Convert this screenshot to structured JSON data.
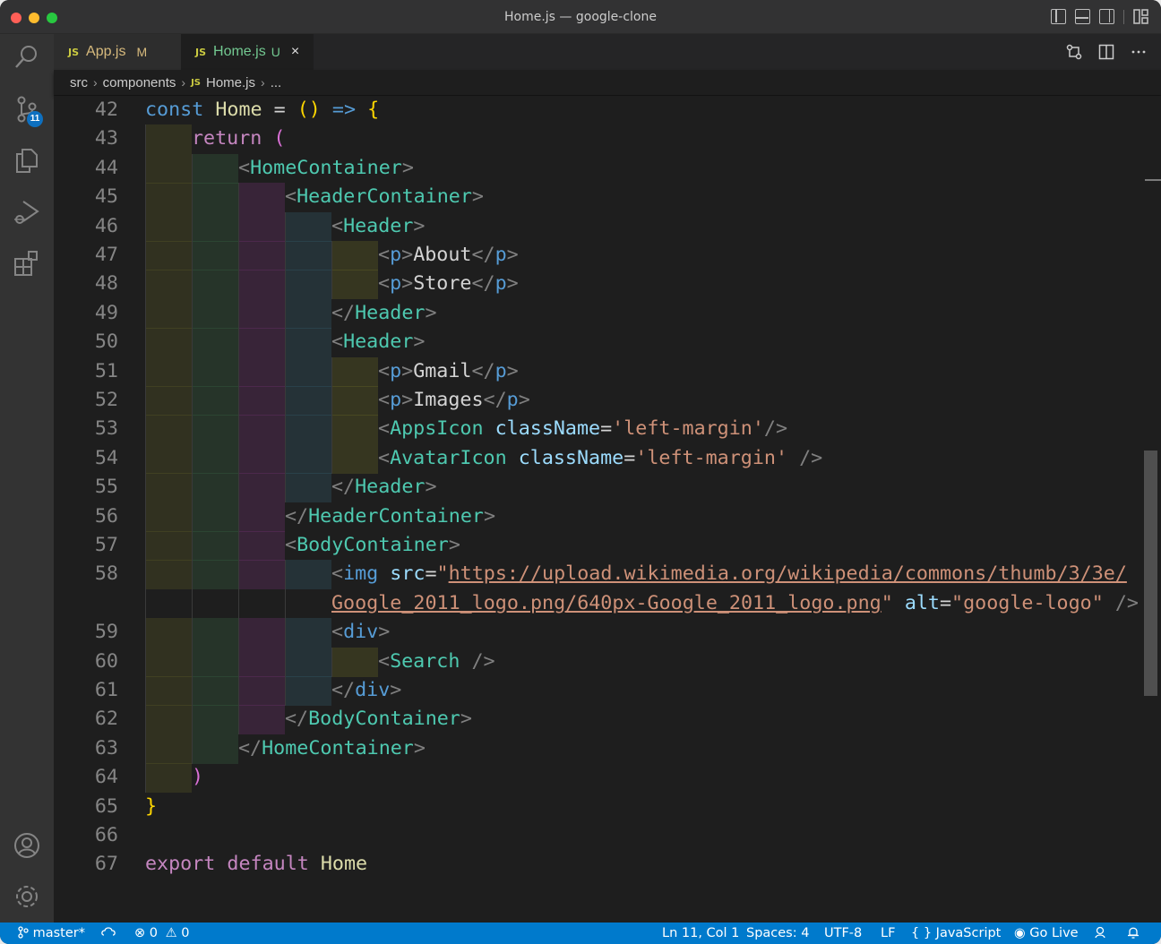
{
  "window": {
    "title": "Home.js — google-clone"
  },
  "activity": {
    "scm_badge": "11"
  },
  "tabs": [
    {
      "icon": "JS",
      "label": "App.js",
      "status": "M"
    },
    {
      "icon": "JS",
      "label": "Home.js",
      "status": "U",
      "close": "×"
    }
  ],
  "breadcrumb": {
    "items": [
      "src",
      "components",
      "Home.js",
      "..."
    ],
    "file_icon": "JS"
  },
  "editor": {
    "line_numbers": [
      "42",
      "43",
      "44",
      "45",
      "46",
      "47",
      "48",
      "49",
      "50",
      "51",
      "52",
      "53",
      "54",
      "55",
      "56",
      "57",
      "58",
      "",
      "59",
      "60",
      "61",
      "62",
      "63",
      "64",
      "65",
      "66",
      "67"
    ],
    "lines": [
      [
        {
          "t": "const ",
          "c": "kw"
        },
        {
          "t": "Home",
          "c": "fn"
        },
        {
          "t": " = ",
          "c": "txt"
        },
        {
          "t": "()",
          "c": "br1"
        },
        {
          "t": " => ",
          "c": "kw"
        },
        {
          "t": "{",
          "c": "br1"
        }
      ],
      [
        {
          "t": "return ",
          "c": "kwc"
        },
        {
          "t": "(",
          "c": "br2"
        }
      ],
      [
        {
          "t": "<",
          "c": "pun"
        },
        {
          "t": "HomeContainer",
          "c": "tag"
        },
        {
          "t": ">",
          "c": "pun"
        }
      ],
      [
        {
          "t": "<",
          "c": "pun"
        },
        {
          "t": "HeaderContainer",
          "c": "tag"
        },
        {
          "t": ">",
          "c": "pun"
        }
      ],
      [
        {
          "t": "<",
          "c": "pun"
        },
        {
          "t": "Header",
          "c": "tag"
        },
        {
          "t": ">",
          "c": "pun"
        }
      ],
      [
        {
          "t": "<",
          "c": "pun"
        },
        {
          "t": "p",
          "c": "htag"
        },
        {
          "t": ">",
          "c": "pun"
        },
        {
          "t": "About",
          "c": "txt"
        },
        {
          "t": "</",
          "c": "pun"
        },
        {
          "t": "p",
          "c": "htag"
        },
        {
          "t": ">",
          "c": "pun"
        }
      ],
      [
        {
          "t": "<",
          "c": "pun"
        },
        {
          "t": "p",
          "c": "htag"
        },
        {
          "t": ">",
          "c": "pun"
        },
        {
          "t": "Store",
          "c": "txt"
        },
        {
          "t": "</",
          "c": "pun"
        },
        {
          "t": "p",
          "c": "htag"
        },
        {
          "t": ">",
          "c": "pun"
        }
      ],
      [
        {
          "t": "</",
          "c": "pun"
        },
        {
          "t": "Header",
          "c": "tag"
        },
        {
          "t": ">",
          "c": "pun"
        }
      ],
      [
        {
          "t": "<",
          "c": "pun"
        },
        {
          "t": "Header",
          "c": "tag"
        },
        {
          "t": ">",
          "c": "pun"
        }
      ],
      [
        {
          "t": "<",
          "c": "pun"
        },
        {
          "t": "p",
          "c": "htag"
        },
        {
          "t": ">",
          "c": "pun"
        },
        {
          "t": "Gmail",
          "c": "txt"
        },
        {
          "t": "</",
          "c": "pun"
        },
        {
          "t": "p",
          "c": "htag"
        },
        {
          "t": ">",
          "c": "pun"
        }
      ],
      [
        {
          "t": "<",
          "c": "pun"
        },
        {
          "t": "p",
          "c": "htag"
        },
        {
          "t": ">",
          "c": "pun"
        },
        {
          "t": "Images",
          "c": "txt"
        },
        {
          "t": "</",
          "c": "pun"
        },
        {
          "t": "p",
          "c": "htag"
        },
        {
          "t": ">",
          "c": "pun"
        }
      ],
      [
        {
          "t": "<",
          "c": "pun"
        },
        {
          "t": "AppsIcon",
          "c": "tag"
        },
        {
          "t": " ",
          "c": "txt"
        },
        {
          "t": "className",
          "c": "attr"
        },
        {
          "t": "=",
          "c": "txt"
        },
        {
          "t": "'left-margin'",
          "c": "str"
        },
        {
          "t": "/>",
          "c": "pun"
        }
      ],
      [
        {
          "t": "<",
          "c": "pun"
        },
        {
          "t": "AvatarIcon",
          "c": "tag"
        },
        {
          "t": " ",
          "c": "txt"
        },
        {
          "t": "className",
          "c": "attr"
        },
        {
          "t": "=",
          "c": "txt"
        },
        {
          "t": "'left-margin'",
          "c": "str"
        },
        {
          "t": " />",
          "c": "pun"
        }
      ],
      [
        {
          "t": "</",
          "c": "pun"
        },
        {
          "t": "Header",
          "c": "tag"
        },
        {
          "t": ">",
          "c": "pun"
        }
      ],
      [
        {
          "t": "</",
          "c": "pun"
        },
        {
          "t": "HeaderContainer",
          "c": "tag"
        },
        {
          "t": ">",
          "c": "pun"
        }
      ],
      [
        {
          "t": "<",
          "c": "pun"
        },
        {
          "t": "BodyContainer",
          "c": "tag"
        },
        {
          "t": ">",
          "c": "pun"
        }
      ],
      [
        {
          "t": "<",
          "c": "pun"
        },
        {
          "t": "img",
          "c": "htag"
        },
        {
          "t": " ",
          "c": "txt"
        },
        {
          "t": "src",
          "c": "attr"
        },
        {
          "t": "=",
          "c": "txt"
        },
        {
          "t": "\"",
          "c": "str"
        },
        {
          "t": "https://upload.wikimedia.org/wikipedia/commons/thumb/3/3e/",
          "c": "url"
        }
      ],
      [
        {
          "t": "Google_2011_logo.png/640px-Google_2011_logo.png",
          "c": "url"
        },
        {
          "t": "\"",
          "c": "str"
        },
        {
          "t": " ",
          "c": "txt"
        },
        {
          "t": "alt",
          "c": "attr"
        },
        {
          "t": "=",
          "c": "txt"
        },
        {
          "t": "\"google-logo\"",
          "c": "str"
        },
        {
          "t": " />",
          "c": "pun"
        }
      ],
      [
        {
          "t": "<",
          "c": "pun"
        },
        {
          "t": "div",
          "c": "htag"
        },
        {
          "t": ">",
          "c": "pun"
        }
      ],
      [
        {
          "t": "<",
          "c": "pun"
        },
        {
          "t": "Search",
          "c": "tag"
        },
        {
          "t": " />",
          "c": "pun"
        }
      ],
      [
        {
          "t": "</",
          "c": "pun"
        },
        {
          "t": "div",
          "c": "htag"
        },
        {
          "t": ">",
          "c": "pun"
        }
      ],
      [
        {
          "t": "</",
          "c": "pun"
        },
        {
          "t": "BodyContainer",
          "c": "tag"
        },
        {
          "t": ">",
          "c": "pun"
        }
      ],
      [
        {
          "t": "</",
          "c": "pun"
        },
        {
          "t": "HomeContainer",
          "c": "tag"
        },
        {
          "t": ">",
          "c": "pun"
        }
      ],
      [
        {
          "t": ")",
          "c": "br2"
        }
      ],
      [
        {
          "t": "}",
          "c": "br1"
        }
      ],
      [],
      [
        {
          "t": "export ",
          "c": "kwc"
        },
        {
          "t": "default ",
          "c": "kwc"
        },
        {
          "t": "Home",
          "c": "fn"
        }
      ]
    ]
  },
  "status": {
    "branch": "master*",
    "errors": "0",
    "warnings": "0",
    "position": "Ln 11, Col 1",
    "spaces": "Spaces: 4",
    "encoding": "UTF-8",
    "eol": "LF",
    "language": "JavaScript",
    "golive": "Go Live"
  },
  "colors": {
    "status_bar": "#007acc",
    "tag": "#4ec9b0",
    "keyword": "#569cd6",
    "string": "#ce9178",
    "attribute": "#9cdcfe"
  }
}
